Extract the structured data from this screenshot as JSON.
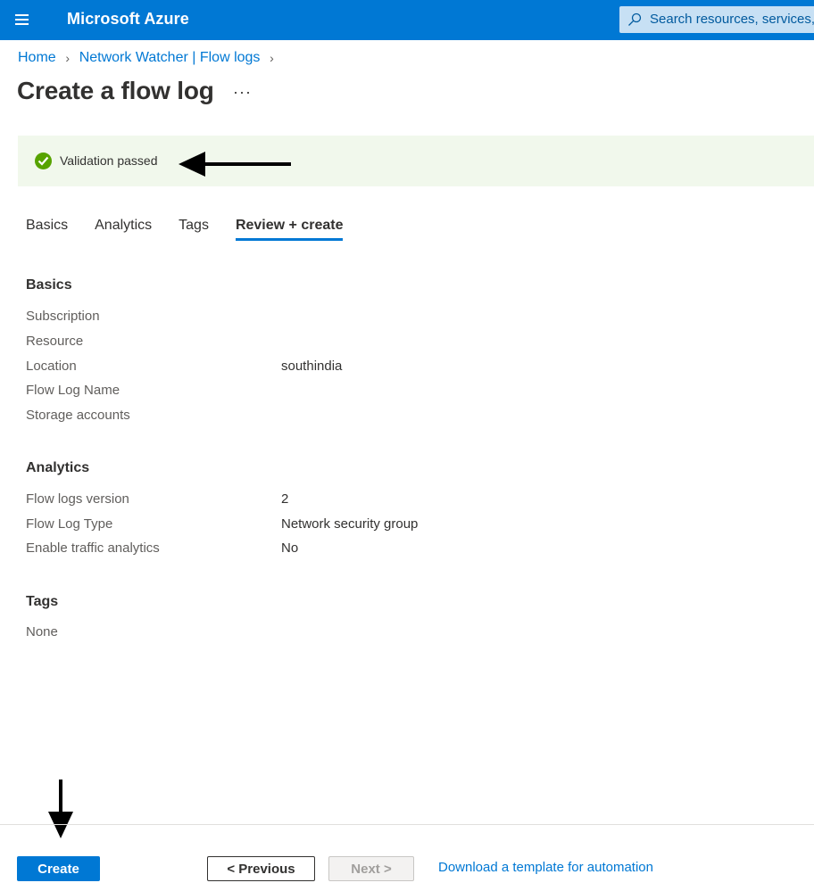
{
  "header": {
    "brand": "Microsoft Azure",
    "menu_icon": "hamburger-icon",
    "search_icon": "search-icon",
    "search_placeholder": "Search resources, services, and docs",
    "accent_color": "#0078d4"
  },
  "breadcrumb": {
    "items": [
      "Home",
      "Network Watcher | Flow logs"
    ],
    "separator_icon": "chevron-right-icon"
  },
  "page": {
    "title": "Create a flow log",
    "more_label": "···"
  },
  "banner": {
    "icon": "check-circle-icon",
    "message": "Validation passed",
    "status_color": "#57a300"
  },
  "tabs": [
    {
      "label": "Basics",
      "active": false
    },
    {
      "label": "Analytics",
      "active": false
    },
    {
      "label": "Tags",
      "active": false
    },
    {
      "label": "Review + create",
      "active": true
    }
  ],
  "sections": {
    "basics": {
      "title": "Basics",
      "rows": [
        {
          "label": "Subscription",
          "value": ""
        },
        {
          "label": "Resource",
          "value": ""
        },
        {
          "label": "Location",
          "value": "southindia"
        },
        {
          "label": "Flow Log Name",
          "value": ""
        },
        {
          "label": "Storage accounts",
          "value": ""
        }
      ]
    },
    "analytics": {
      "title": "Analytics",
      "rows": [
        {
          "label": "Flow logs version",
          "value": "2"
        },
        {
          "label": "Flow Log Type",
          "value": "Network security group"
        },
        {
          "label": "Enable traffic analytics",
          "value": "No"
        }
      ]
    },
    "tags": {
      "title": "Tags",
      "rows": [
        {
          "label": "None",
          "value": ""
        }
      ]
    }
  },
  "footer": {
    "create_label": "Create",
    "previous_label": "< Previous",
    "next_label": "Next >",
    "download_label": "Download a template for automation"
  }
}
